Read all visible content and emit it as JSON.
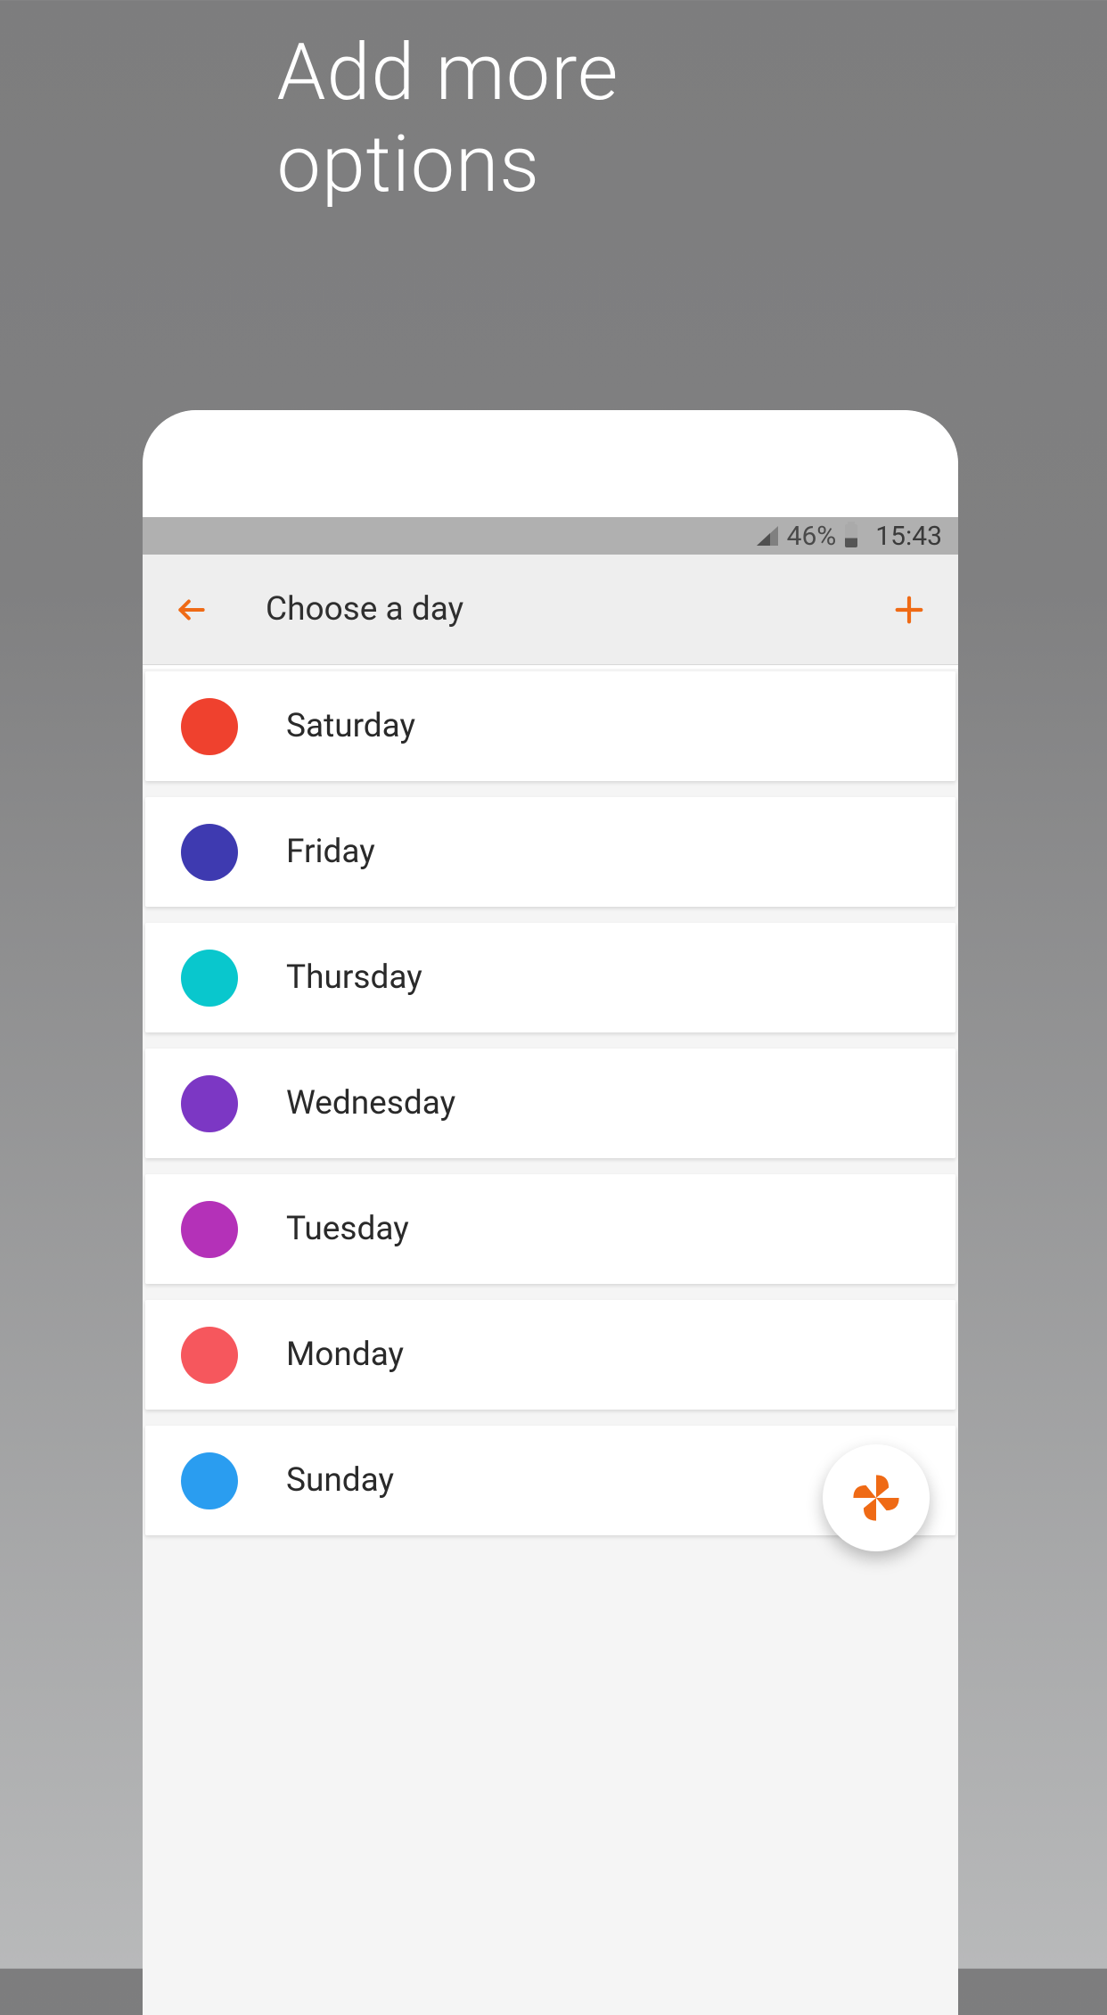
{
  "promo": {
    "title": "Add more options"
  },
  "status_bar": {
    "battery_percent": "46%",
    "time": "15:43"
  },
  "app_bar": {
    "title": "Choose a day"
  },
  "colors": {
    "accent": "#ef6a15"
  },
  "days": [
    {
      "label": "Saturday",
      "color": "#ef412e"
    },
    {
      "label": "Friday",
      "color": "#3e3ab0"
    },
    {
      "label": "Thursday",
      "color": "#09c7cd"
    },
    {
      "label": "Wednesday",
      "color": "#7c37c4"
    },
    {
      "label": "Tuesday",
      "color": "#b431b8"
    },
    {
      "label": "Monday",
      "color": "#f6575d"
    },
    {
      "label": "Sunday",
      "color": "#2a9df0"
    }
  ]
}
